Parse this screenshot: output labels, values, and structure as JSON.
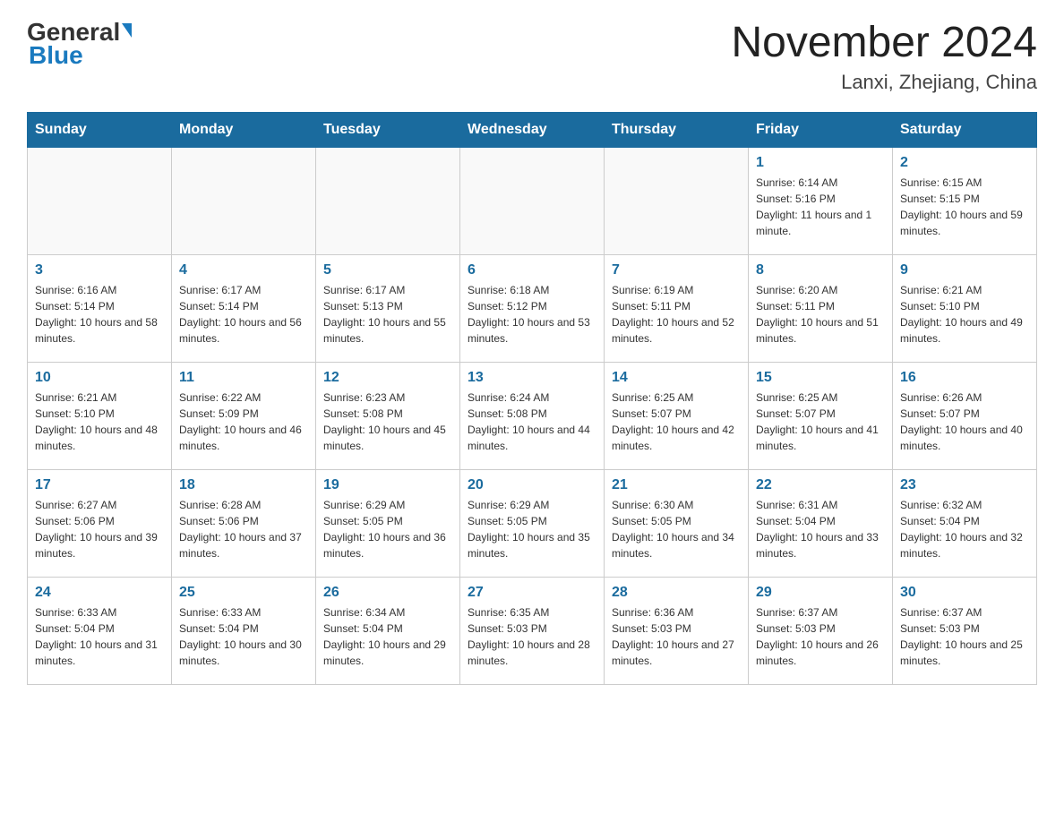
{
  "header": {
    "logo_general": "General",
    "logo_blue": "Blue",
    "month_title": "November 2024",
    "location": "Lanxi, Zhejiang, China"
  },
  "weekdays": [
    "Sunday",
    "Monday",
    "Tuesday",
    "Wednesday",
    "Thursday",
    "Friday",
    "Saturday"
  ],
  "weeks": [
    [
      {
        "day": "",
        "info": ""
      },
      {
        "day": "",
        "info": ""
      },
      {
        "day": "",
        "info": ""
      },
      {
        "day": "",
        "info": ""
      },
      {
        "day": "",
        "info": ""
      },
      {
        "day": "1",
        "info": "Sunrise: 6:14 AM\nSunset: 5:16 PM\nDaylight: 11 hours and 1 minute."
      },
      {
        "day": "2",
        "info": "Sunrise: 6:15 AM\nSunset: 5:15 PM\nDaylight: 10 hours and 59 minutes."
      }
    ],
    [
      {
        "day": "3",
        "info": "Sunrise: 6:16 AM\nSunset: 5:14 PM\nDaylight: 10 hours and 58 minutes."
      },
      {
        "day": "4",
        "info": "Sunrise: 6:17 AM\nSunset: 5:14 PM\nDaylight: 10 hours and 56 minutes."
      },
      {
        "day": "5",
        "info": "Sunrise: 6:17 AM\nSunset: 5:13 PM\nDaylight: 10 hours and 55 minutes."
      },
      {
        "day": "6",
        "info": "Sunrise: 6:18 AM\nSunset: 5:12 PM\nDaylight: 10 hours and 53 minutes."
      },
      {
        "day": "7",
        "info": "Sunrise: 6:19 AM\nSunset: 5:11 PM\nDaylight: 10 hours and 52 minutes."
      },
      {
        "day": "8",
        "info": "Sunrise: 6:20 AM\nSunset: 5:11 PM\nDaylight: 10 hours and 51 minutes."
      },
      {
        "day": "9",
        "info": "Sunrise: 6:21 AM\nSunset: 5:10 PM\nDaylight: 10 hours and 49 minutes."
      }
    ],
    [
      {
        "day": "10",
        "info": "Sunrise: 6:21 AM\nSunset: 5:10 PM\nDaylight: 10 hours and 48 minutes."
      },
      {
        "day": "11",
        "info": "Sunrise: 6:22 AM\nSunset: 5:09 PM\nDaylight: 10 hours and 46 minutes."
      },
      {
        "day": "12",
        "info": "Sunrise: 6:23 AM\nSunset: 5:08 PM\nDaylight: 10 hours and 45 minutes."
      },
      {
        "day": "13",
        "info": "Sunrise: 6:24 AM\nSunset: 5:08 PM\nDaylight: 10 hours and 44 minutes."
      },
      {
        "day": "14",
        "info": "Sunrise: 6:25 AM\nSunset: 5:07 PM\nDaylight: 10 hours and 42 minutes."
      },
      {
        "day": "15",
        "info": "Sunrise: 6:25 AM\nSunset: 5:07 PM\nDaylight: 10 hours and 41 minutes."
      },
      {
        "day": "16",
        "info": "Sunrise: 6:26 AM\nSunset: 5:07 PM\nDaylight: 10 hours and 40 minutes."
      }
    ],
    [
      {
        "day": "17",
        "info": "Sunrise: 6:27 AM\nSunset: 5:06 PM\nDaylight: 10 hours and 39 minutes."
      },
      {
        "day": "18",
        "info": "Sunrise: 6:28 AM\nSunset: 5:06 PM\nDaylight: 10 hours and 37 minutes."
      },
      {
        "day": "19",
        "info": "Sunrise: 6:29 AM\nSunset: 5:05 PM\nDaylight: 10 hours and 36 minutes."
      },
      {
        "day": "20",
        "info": "Sunrise: 6:29 AM\nSunset: 5:05 PM\nDaylight: 10 hours and 35 minutes."
      },
      {
        "day": "21",
        "info": "Sunrise: 6:30 AM\nSunset: 5:05 PM\nDaylight: 10 hours and 34 minutes."
      },
      {
        "day": "22",
        "info": "Sunrise: 6:31 AM\nSunset: 5:04 PM\nDaylight: 10 hours and 33 minutes."
      },
      {
        "day": "23",
        "info": "Sunrise: 6:32 AM\nSunset: 5:04 PM\nDaylight: 10 hours and 32 minutes."
      }
    ],
    [
      {
        "day": "24",
        "info": "Sunrise: 6:33 AM\nSunset: 5:04 PM\nDaylight: 10 hours and 31 minutes."
      },
      {
        "day": "25",
        "info": "Sunrise: 6:33 AM\nSunset: 5:04 PM\nDaylight: 10 hours and 30 minutes."
      },
      {
        "day": "26",
        "info": "Sunrise: 6:34 AM\nSunset: 5:04 PM\nDaylight: 10 hours and 29 minutes."
      },
      {
        "day": "27",
        "info": "Sunrise: 6:35 AM\nSunset: 5:03 PM\nDaylight: 10 hours and 28 minutes."
      },
      {
        "day": "28",
        "info": "Sunrise: 6:36 AM\nSunset: 5:03 PM\nDaylight: 10 hours and 27 minutes."
      },
      {
        "day": "29",
        "info": "Sunrise: 6:37 AM\nSunset: 5:03 PM\nDaylight: 10 hours and 26 minutes."
      },
      {
        "day": "30",
        "info": "Sunrise: 6:37 AM\nSunset: 5:03 PM\nDaylight: 10 hours and 25 minutes."
      }
    ]
  ]
}
